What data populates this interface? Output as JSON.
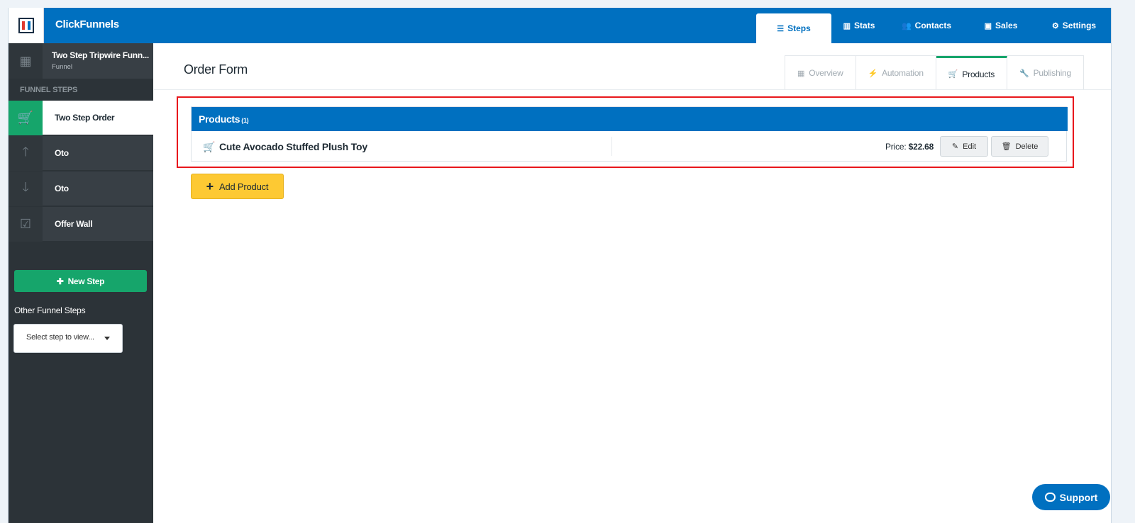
{
  "app": {
    "brand": "ClickFunnels"
  },
  "topnav": [
    {
      "id": "steps",
      "label": "Steps",
      "icon": "list-icon",
      "glyph": "☰"
    },
    {
      "id": "stats",
      "label": "Stats",
      "icon": "chart-icon",
      "glyph": "▥"
    },
    {
      "id": "contacts",
      "label": "Contacts",
      "icon": "users-icon",
      "glyph": "👥"
    },
    {
      "id": "sales",
      "label": "Sales",
      "icon": "money-icon",
      "glyph": "▣"
    },
    {
      "id": "settings",
      "label": "Settings",
      "icon": "gear-icon",
      "glyph": "⚙"
    }
  ],
  "sidebar": {
    "funnel_title": "Two Step Tripwire Funn...",
    "funnel_subtitle": "Funnel",
    "section_label": "FUNNEL STEPS",
    "steps": [
      {
        "label": "Two Step Order",
        "icon": "cart-icon",
        "glyph": "🛒",
        "active": true
      },
      {
        "label": "Oto",
        "icon": "arrow-up-icon",
        "glyph": "🡑",
        "active": false
      },
      {
        "label": "Oto",
        "icon": "arrow-down-icon",
        "glyph": "🡓",
        "active": false
      },
      {
        "label": "Offer Wall",
        "icon": "check-square-icon",
        "glyph": "☑",
        "active": false
      }
    ],
    "new_step_label": "New Step",
    "other_steps_label": "Other Funnel Steps",
    "select_placeholder": "Select step to view..."
  },
  "main": {
    "page_title": "Order Form",
    "subtabs": [
      {
        "label": "Overview",
        "icon": "grid-icon",
        "glyph": "▦"
      },
      {
        "label": "Automation",
        "icon": "bolt-icon",
        "glyph": "⚡"
      },
      {
        "label": "Products",
        "icon": "cart-icon",
        "glyph": "🛒"
      },
      {
        "label": "Publishing",
        "icon": "wrench-icon",
        "glyph": "🔧"
      }
    ],
    "active_subtab": "Products",
    "products_panel": {
      "title": "Products",
      "count": "(1)",
      "items": [
        {
          "name": "Cute Avocado Stuffed Plush Toy",
          "price_label": "Price:",
          "price": "$22.68"
        }
      ],
      "edit_label": "Edit",
      "delete_label": "Delete"
    },
    "add_product_label": "Add Product"
  },
  "support_label": "Support",
  "colors": {
    "primary": "#0070c0",
    "success": "#16a56b",
    "warning": "#fdc933",
    "highlight": "#e8171c",
    "sidebar": "#2c3338"
  }
}
